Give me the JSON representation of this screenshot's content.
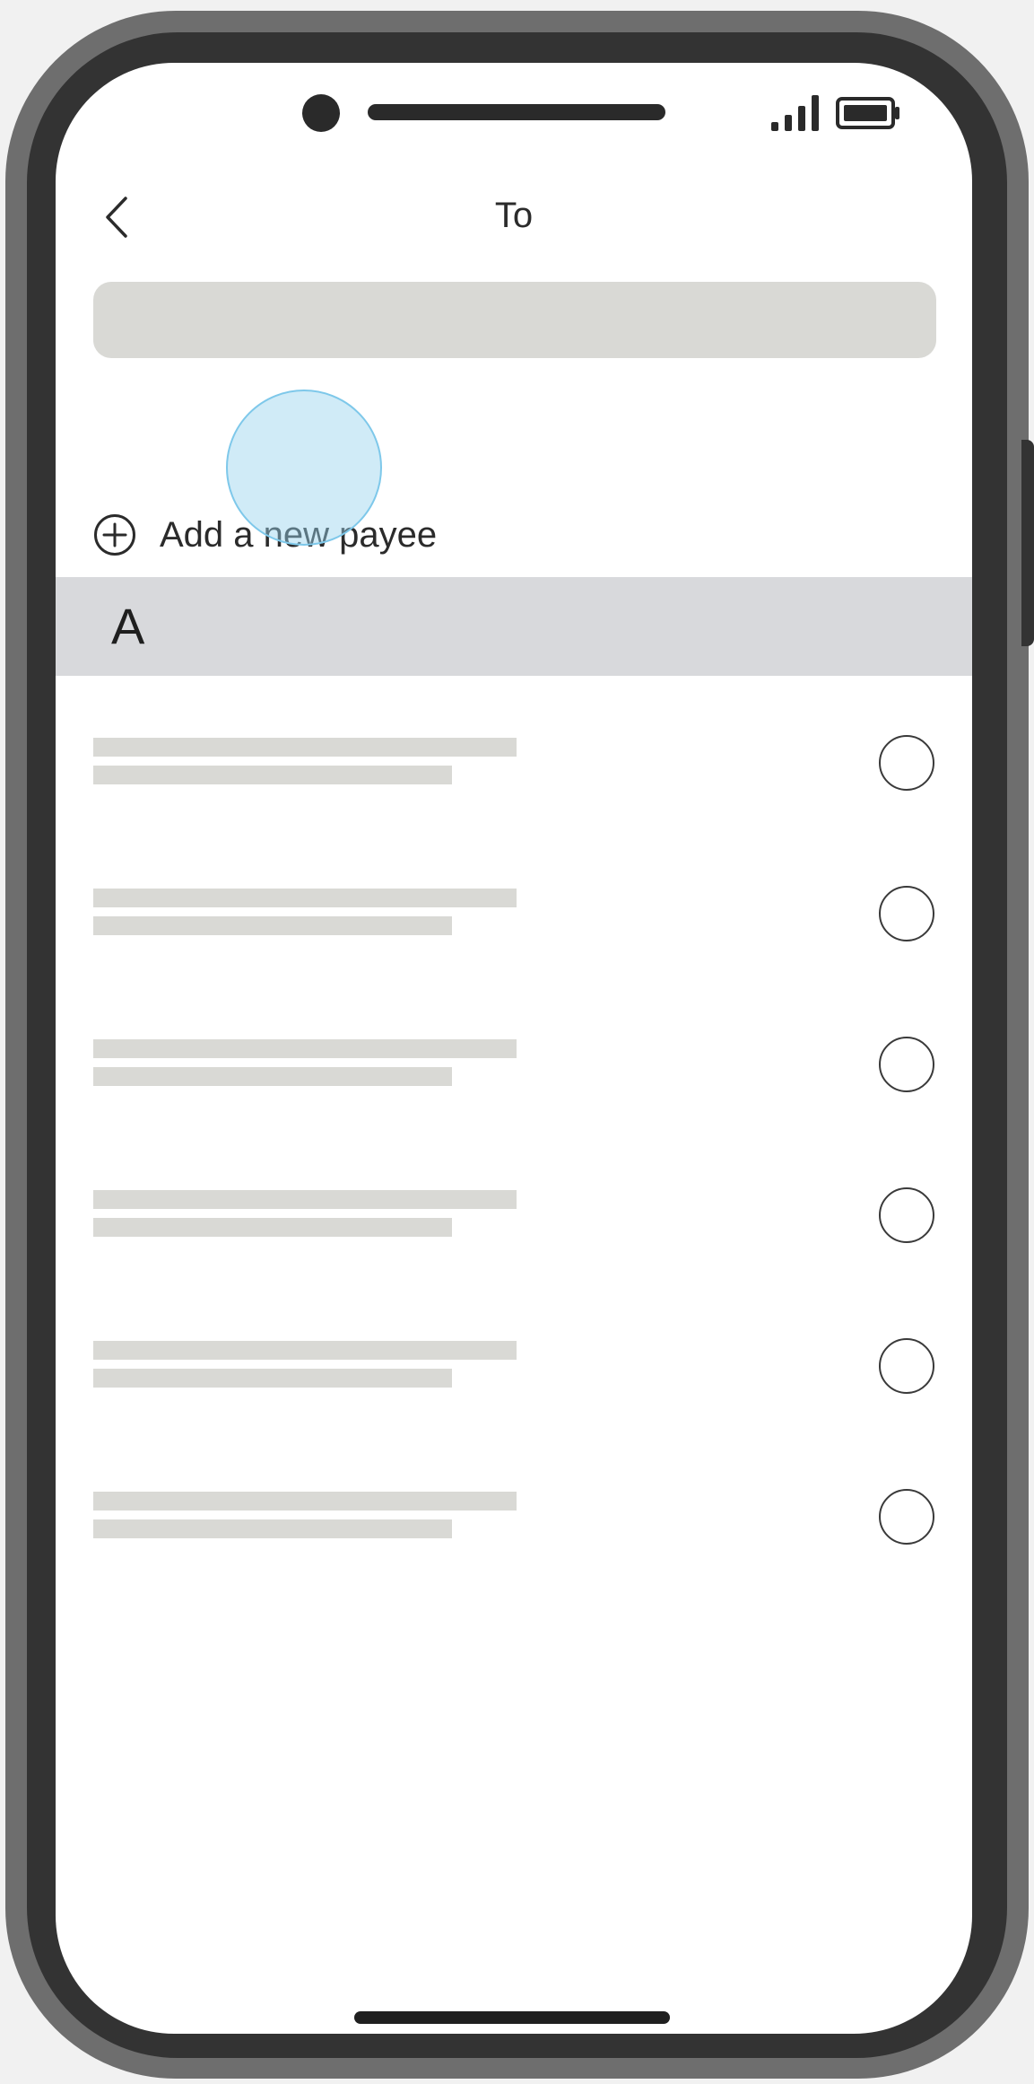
{
  "header": {
    "title": "To",
    "back_icon": "chevron-left-icon"
  },
  "status_bar": {
    "signal_icon": "cellular-signal-icon",
    "battery_icon": "battery-icon"
  },
  "search": {
    "value": ""
  },
  "add_payee": {
    "icon": "plus-circle-icon",
    "label": "Add a new payee"
  },
  "section": {
    "letter": "A"
  },
  "payees": [
    {
      "selected": false
    },
    {
      "selected": false
    },
    {
      "selected": false
    },
    {
      "selected": false
    },
    {
      "selected": false
    },
    {
      "selected": false
    }
  ],
  "colors": {
    "accent_touch": "#96d2ee",
    "placeholder": "#d9d9d5",
    "section_bg": "#d8d9dc",
    "frame": "#333333"
  }
}
